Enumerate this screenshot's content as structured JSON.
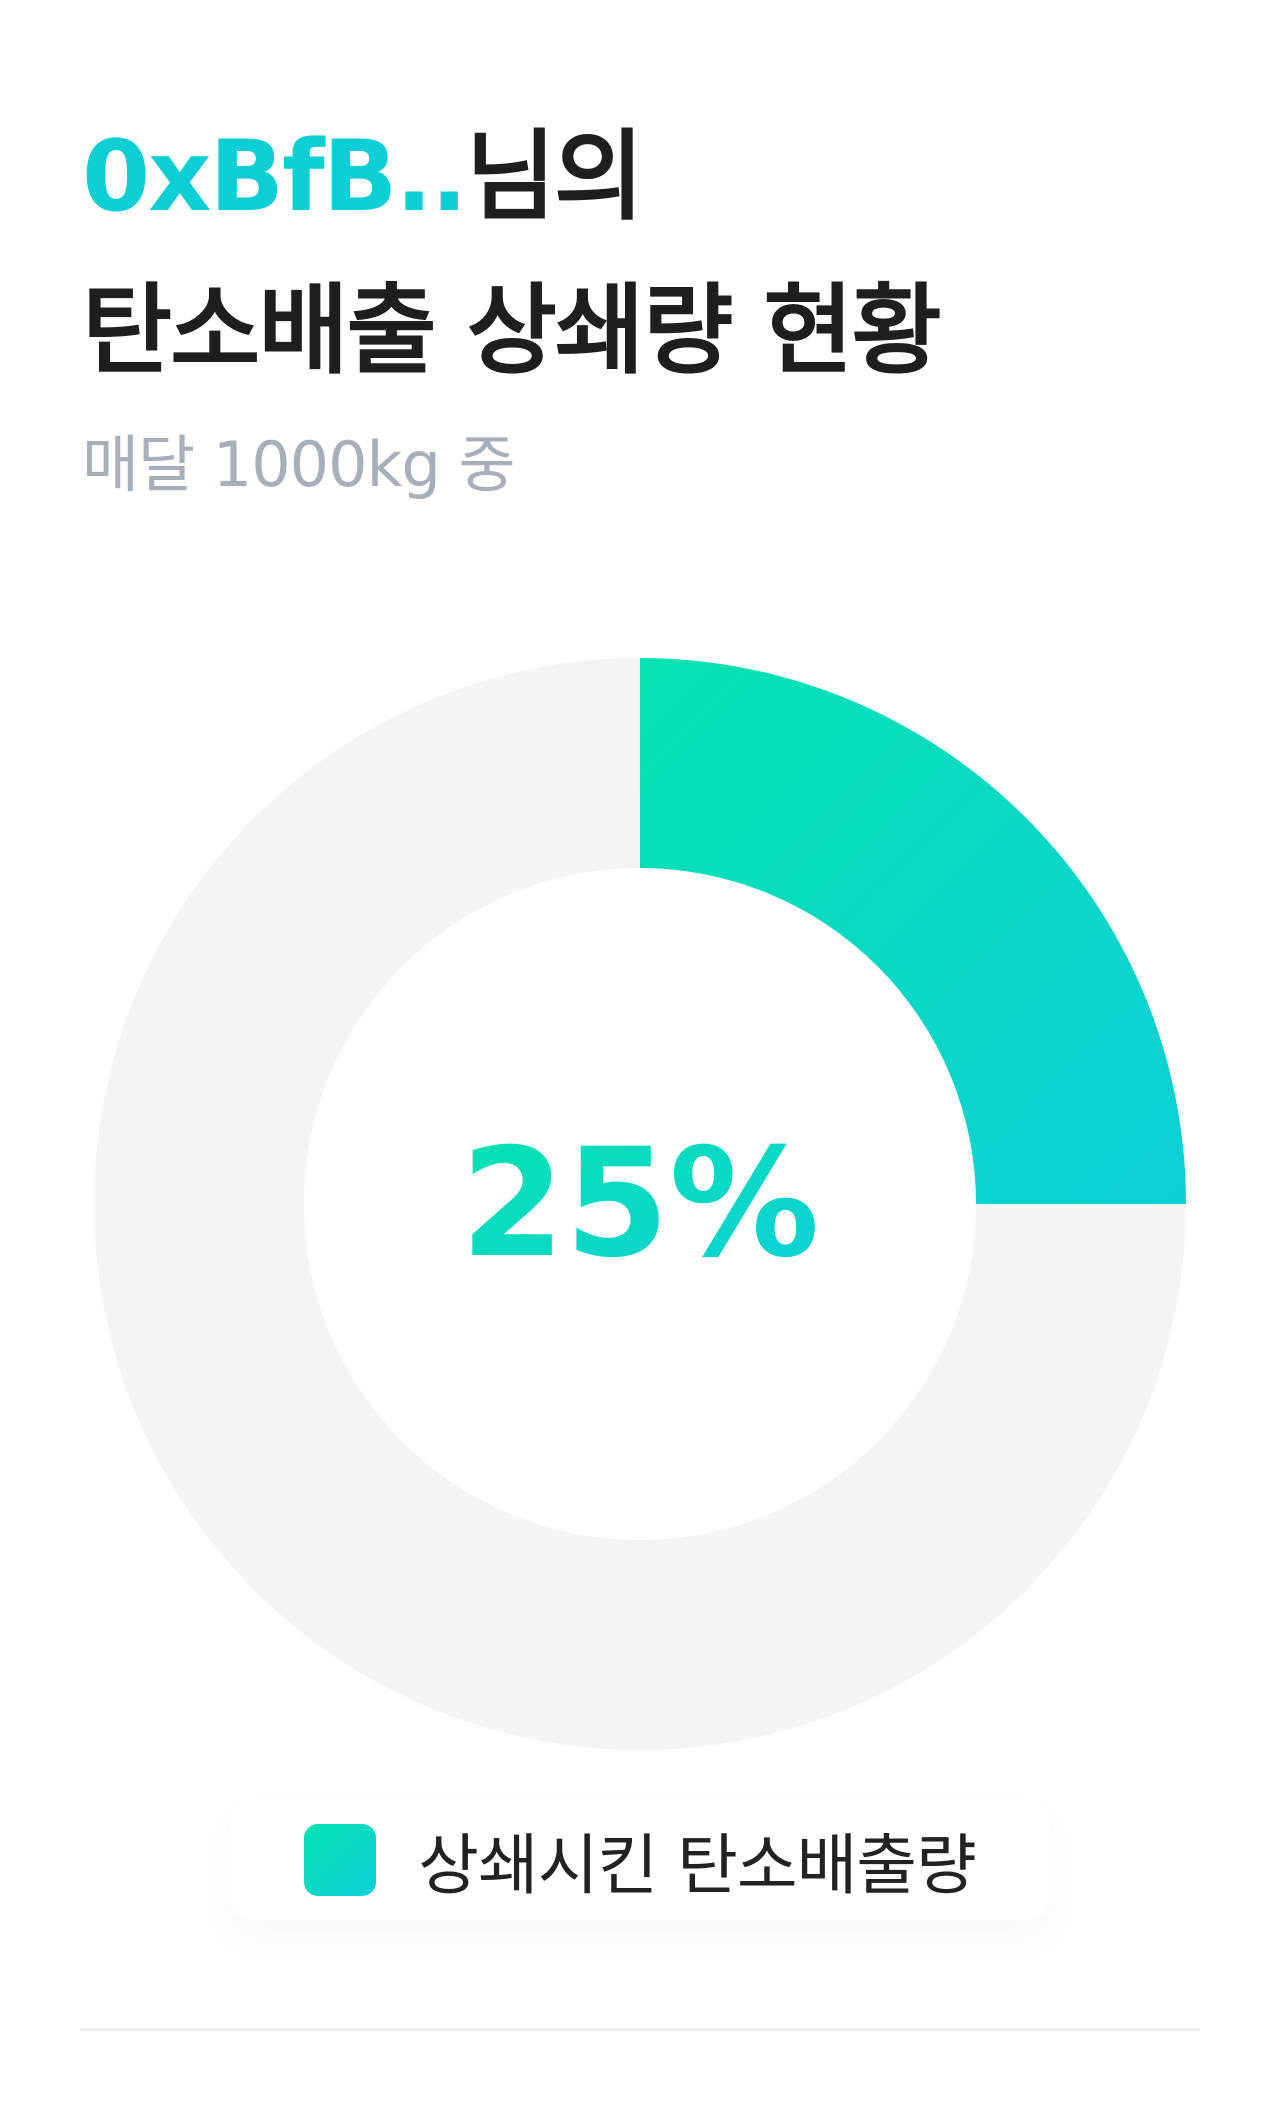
{
  "header": {
    "user_name": "0xBfB..",
    "title_suffix": "님의",
    "title_line2": "탄소배출 상쇄량 현황",
    "subtitle": "매달 1000kg 중"
  },
  "colors": {
    "accent_start": "#06e3b1",
    "accent_end": "#0ccfd6",
    "track": "#f3f5f5",
    "title": "#1e1e1e",
    "subtitle": "#a7b0ba"
  },
  "chart_data": {
    "type": "pie",
    "title": "",
    "center_label": "25%",
    "series": [
      {
        "name": "상쇄시킨 탄소배출량",
        "value": 25,
        "color": "accent-gradient"
      }
    ],
    "remainder": 75,
    "total": 100,
    "start_position": "top",
    "direction": "clockwise"
  },
  "legend": {
    "items": [
      {
        "label": "상쇄시킨 탄소배출량"
      }
    ]
  }
}
